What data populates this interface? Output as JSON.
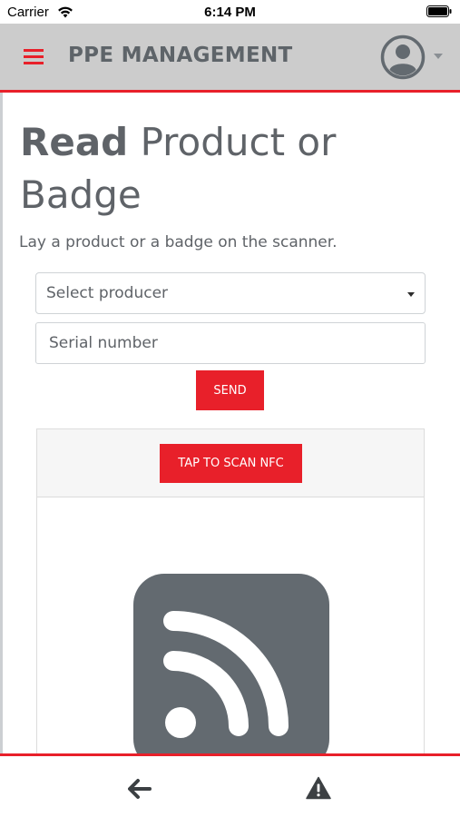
{
  "status_bar": {
    "carrier": "Carrier",
    "time": "6:14 PM",
    "wifi_icon": "wifi-icon",
    "battery_icon": "battery-icon"
  },
  "header": {
    "menu_icon": "hamburger-menu-icon",
    "title": "PPE MANAGEMENT",
    "avatar_icon": "user-avatar-icon",
    "dropdown_icon": "caret-down-icon"
  },
  "page": {
    "title_bold": "Read",
    "title_rest": " Product or Badge",
    "subtitle": "Lay a product or a badge on the scanner."
  },
  "form": {
    "producer_select": {
      "selected": "Select producer"
    },
    "serial_input": {
      "placeholder": "Serial number",
      "value": ""
    },
    "send_label": "SEND"
  },
  "scanner": {
    "scan_label": "TAP TO SCAN NFC",
    "icon": "nfc-rss-icon"
  },
  "bottom_nav": {
    "back_icon": "arrow-left-icon",
    "warning_icon": "warning-triangle-icon"
  },
  "colors": {
    "accent": "#e8202a",
    "header_bg": "#cccccc",
    "text": "#5f6368",
    "icon": "#636a70"
  }
}
